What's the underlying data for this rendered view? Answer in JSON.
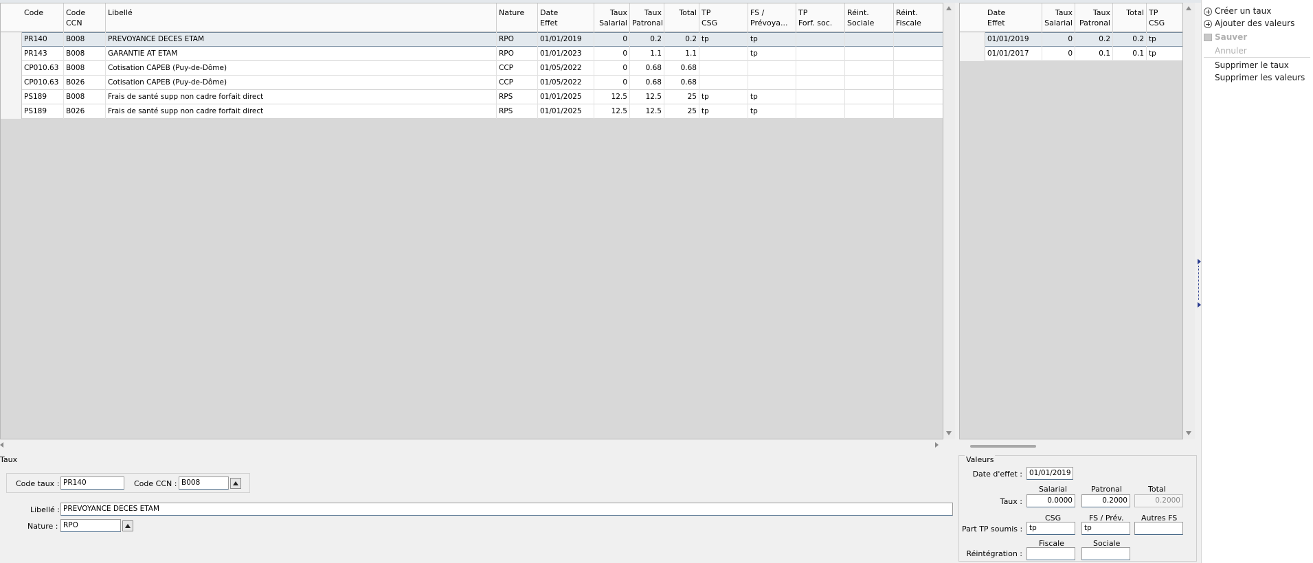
{
  "main_grid": {
    "columns": [
      "Code",
      "Code CCN",
      "Libellé",
      "Nature",
      "Date\nEffet",
      "Taux\nSalarial",
      "Taux\nPatronal",
      "Total",
      "TP\nCSG",
      "FS /\nPrévoya...",
      "TP\nForf. soc.",
      "Réint.\nSociale",
      "Réint.\nFiscale"
    ],
    "rows": [
      [
        "PR140",
        "B008",
        "PREVOYANCE DECES ETAM",
        "RPO",
        "01/01/2019",
        "0",
        "0.2",
        "0.2",
        "tp",
        "tp",
        "",
        "",
        ""
      ],
      [
        "PR143",
        "B008",
        "GARANTIE AT ETAM",
        "RPO",
        "01/01/2023",
        "0",
        "1.1",
        "1.1",
        "",
        "tp",
        "",
        "",
        ""
      ],
      [
        "CP010.63",
        "B008",
        "Cotisation CAPEB (Puy-de-Dôme)",
        "CCP",
        "01/05/2022",
        "0",
        "0.68",
        "0.68",
        "",
        "",
        "",
        "",
        ""
      ],
      [
        "CP010.63",
        "B026",
        "Cotisation CAPEB (Puy-de-Dôme)",
        "CCP",
        "01/05/2022",
        "0",
        "0.68",
        "0.68",
        "",
        "",
        "",
        "",
        ""
      ],
      [
        "PS189",
        "B008",
        "Frais de santé supp non cadre forfait direct",
        "RPS",
        "01/01/2025",
        "12.5",
        "12.5",
        "25",
        "tp",
        "tp",
        "",
        "",
        ""
      ],
      [
        "PS189",
        "B026",
        "Frais de santé supp non cadre forfait direct",
        "RPS",
        "01/01/2025",
        "12.5",
        "12.5",
        "25",
        "tp",
        "tp",
        "",
        "",
        ""
      ]
    ],
    "selected_row": 0
  },
  "values_grid": {
    "columns": [
      "Date\nEffet",
      "Taux\nSalarial",
      "Taux\nPatronal",
      "Total",
      "TP\nCSG"
    ],
    "rows": [
      [
        "01/01/2019",
        "0",
        "0.2",
        "0.2",
        "tp"
      ],
      [
        "01/01/2017",
        "0",
        "0.1",
        "0.1",
        "tp"
      ]
    ],
    "selected_row": 0
  },
  "actions": {
    "create_rate": "Créer un taux",
    "add_values": "Ajouter des valeurs",
    "save": "Sauver",
    "cancel": "Annuler",
    "delete_rate": "Supprimer le taux",
    "delete_values": "Supprimer les valeurs"
  },
  "taux_panel": {
    "title": "Taux",
    "code_taux_label": "Code taux :",
    "code_taux_value": "PR140",
    "code_ccn_label": "Code CCN :",
    "code_ccn_value": "B008",
    "libelle_label": "Libellé :",
    "libelle_value": "PREVOYANCE DECES ETAM",
    "nature_label": "Nature :",
    "nature_value": "RPO"
  },
  "valeurs_panel": {
    "title": "Valeurs",
    "date_effet_label": "Date d'effet :",
    "date_effet_value": "01/01/2019",
    "col_salarial": "Salarial",
    "col_patronal": "Patronal",
    "col_total": "Total",
    "taux_label": "Taux :",
    "taux_salarial": "0.0000",
    "taux_patronal": "0.2000",
    "taux_total": "0.2000",
    "col_csg": "CSG",
    "col_fs_prev": "FS / Prév.",
    "col_autres_fs": "Autres FS",
    "part_tp_label": "Part TP soumis :",
    "part_tp_csg": "tp",
    "part_tp_fs": "tp",
    "part_tp_autres": "",
    "col_fiscale": "Fiscale",
    "col_sociale": "Sociale",
    "reint_label": "Réintégration :",
    "reint_fiscale": "",
    "reint_sociale": ""
  }
}
